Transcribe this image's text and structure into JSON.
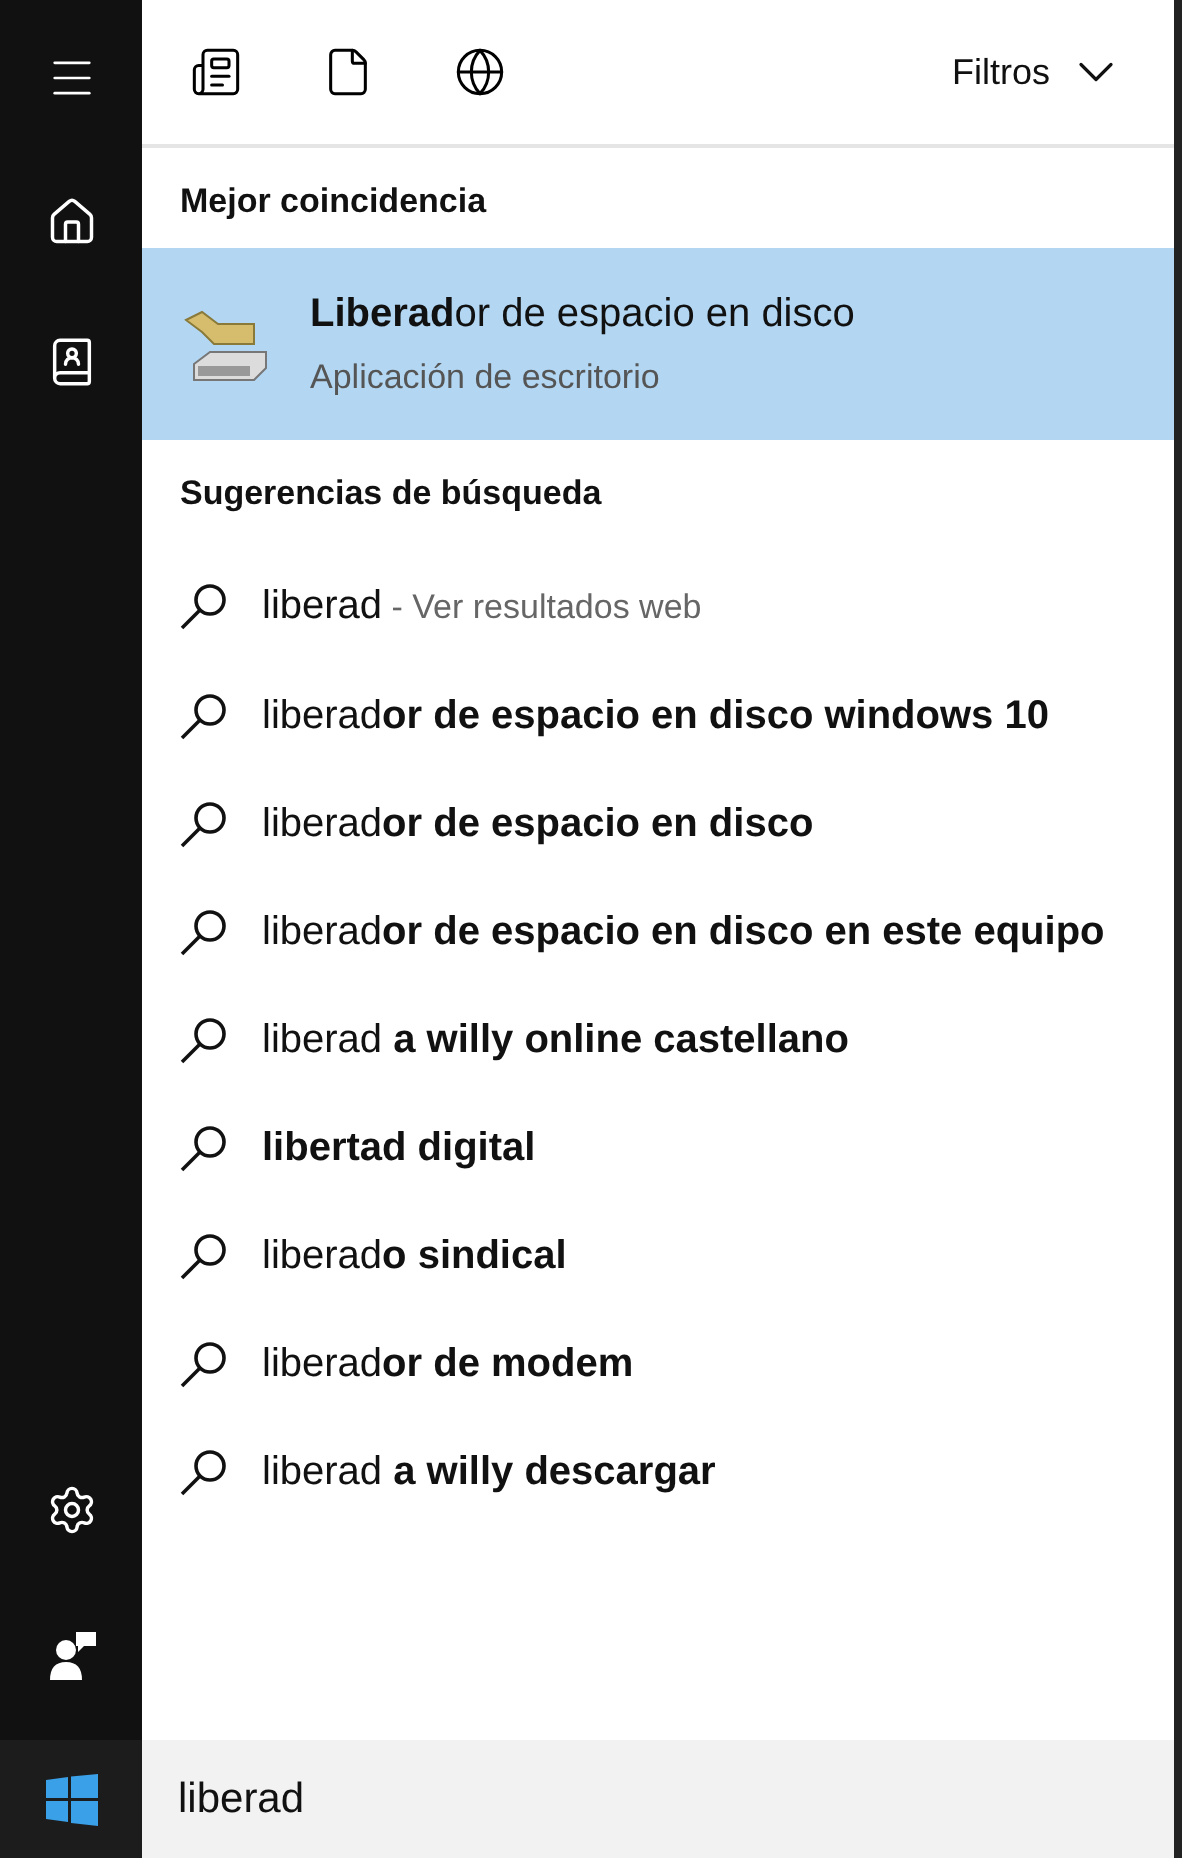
{
  "filters": {
    "label": "Filtros"
  },
  "best_match": {
    "heading": "Mejor coincidencia",
    "title": "**Liberad**or de espacio en disco",
    "subtitle": "Aplicación de escritorio",
    "selected": true
  },
  "suggestions": {
    "heading": "Sugerencias de búsqueda",
    "items": [
      {
        "text": "liberad",
        "hint": "- Ver resultados web"
      },
      {
        "text": "liberad**or de espacio en disco windows 10**"
      },
      {
        "text": "liberad**or de espacio en disco**"
      },
      {
        "text": "liberad**or de espacio en disco en este equipo**"
      },
      {
        "text": "liberad **a willy online castellano**"
      },
      {
        "text": "**libertad digital**"
      },
      {
        "text": "liberad**o sindical**"
      },
      {
        "text": "liberad**or de modem**"
      },
      {
        "text": "liberad **a willy descargar**"
      }
    ]
  },
  "search": {
    "value": "liberad"
  }
}
